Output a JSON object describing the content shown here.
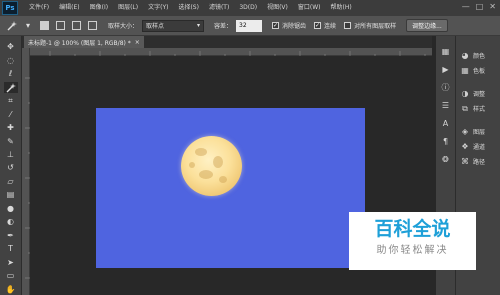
{
  "app": {
    "logo_text": "Ps"
  },
  "menu": [
    "文件(F)",
    "编辑(E)",
    "图像(I)",
    "图层(L)",
    "文字(Y)",
    "选择(S)",
    "滤镜(T)",
    "3D(D)",
    "视图(V)",
    "窗口(W)",
    "帮助(H)"
  ],
  "window_controls": {
    "minimize": "—",
    "restore": "□",
    "close": "✕"
  },
  "options_bar": {
    "sample_size_label": "取样大小：",
    "sample_size_value": "取样点",
    "tolerance_label": "容差：",
    "tolerance_value": "32",
    "antialias_label": "消除锯齿",
    "antialias_checked": true,
    "contiguous_label": "连续",
    "contiguous_checked": true,
    "sample_all_layers_label": "对所有图层取样",
    "sample_all_layers_checked": false,
    "refine_edge_button": "调整边缘..."
  },
  "document": {
    "tab_title": "未标题-1 @ 100% (图层 1, RGB/8) *",
    "tab_close": "×",
    "canvas_color": "#4f64e0"
  },
  "tools": [
    "move-icon",
    "marquee-icon",
    "lasso-icon",
    "magic-wand-icon",
    "crop-icon",
    "eyedropper-icon",
    "healing-icon",
    "brush-icon",
    "stamp-icon",
    "history-brush-icon",
    "eraser-icon",
    "gradient-icon",
    "blur-icon",
    "dodge-icon",
    "pen-icon",
    "type-icon",
    "path-select-icon",
    "shape-icon",
    "hand-icon"
  ],
  "panels": {
    "colors_label": "颜色",
    "swatches_label": "色板",
    "adjustments_label": "调整",
    "styles_label": "样式",
    "layers_label": "图层",
    "channels_label": "通道",
    "paths_label": "路径"
  },
  "watermark": {
    "title": "百科全说",
    "subtitle": "助你轻松解决"
  }
}
